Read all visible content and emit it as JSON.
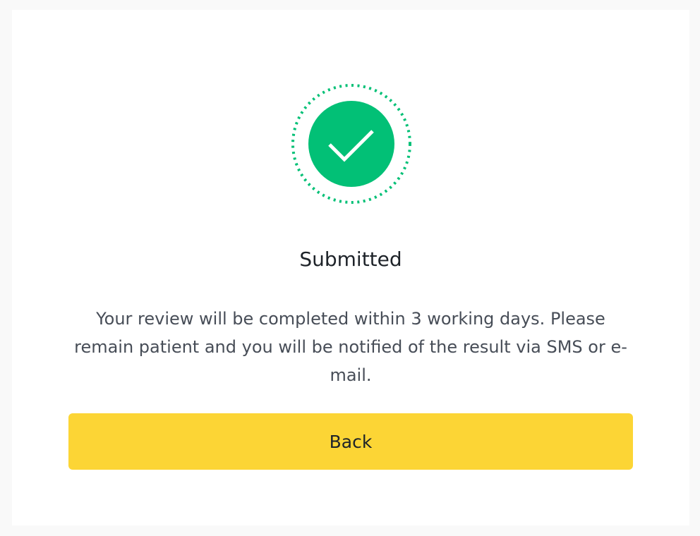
{
  "status": {
    "icon": "check-circle-icon",
    "accent_color": "#02c076",
    "title": "Submitted",
    "message": "Your review will be completed within 3 working days. Please remain patient and you will be notified of the result via SMS or e-mail."
  },
  "actions": {
    "back_label": "Back",
    "back_color": "#fcd535"
  }
}
